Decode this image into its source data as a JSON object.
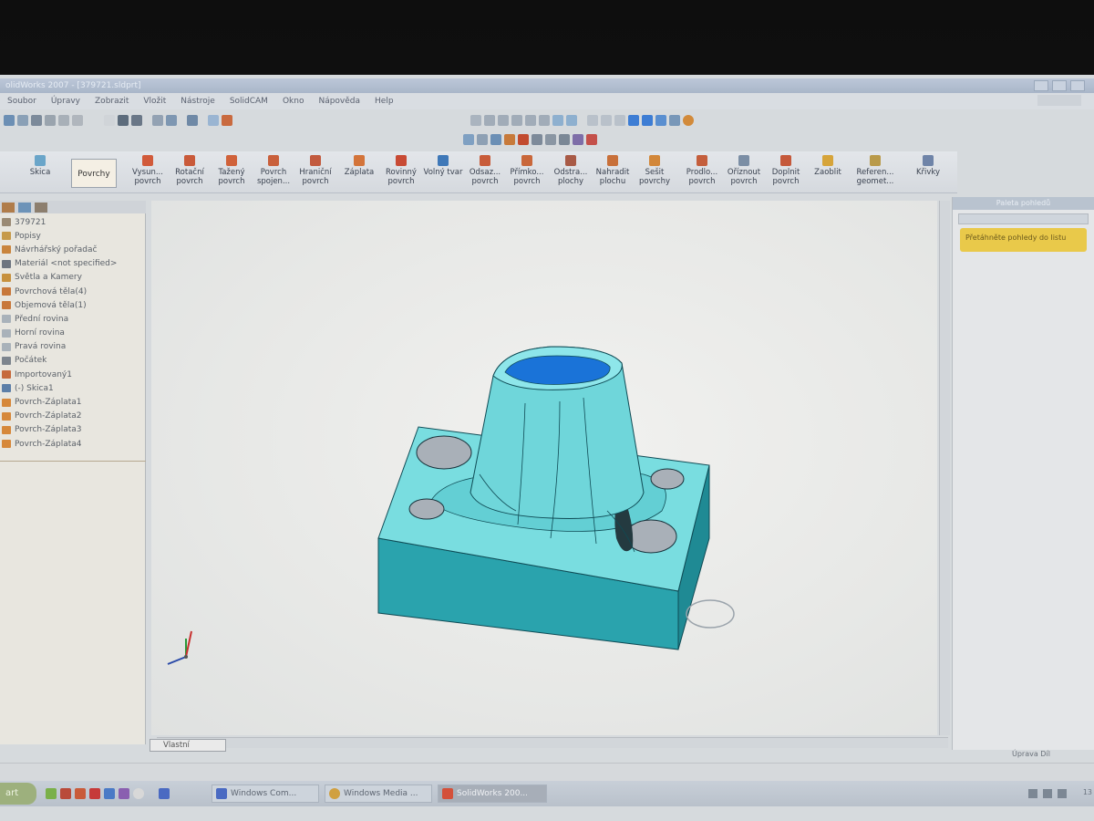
{
  "window": {
    "title": "olidWorks 2007 - [379721.sldprt]"
  },
  "menu": [
    "Soubor",
    "Úpravy",
    "Zobrazit",
    "Vložit",
    "Nástroje",
    "SolidCAM",
    "Okno",
    "Nápověda",
    "Help"
  ],
  "command_manager": {
    "sketch": "Skica",
    "surfaces": "Povrchy",
    "buttons": [
      "Vysun... povrch",
      "Rotační povrch",
      "Tažený povrch",
      "Povrch spojen...",
      "Hraniční povrch",
      "Záplata",
      "Rovinný povrch",
      "Volný tvar",
      "Odsaz... povrch",
      "Přímko... povrch",
      "Odstra... plochy",
      "Nahradit plochu",
      "Sešit povrchy",
      "Prodlo... povrch",
      "Oříznout povrch",
      "Doplnit povrch",
      "Zaoblit",
      "Referen... geomet...",
      "Křivky"
    ]
  },
  "feature_tree": [
    "379721",
    "Popisy",
    "Návrhářský pořadač",
    "Materiál <not specified>",
    "Světla a Kamery",
    "Povrchová těla(4)",
    "Objemová těla(1)",
    "Přední rovina",
    "Horní rovina",
    "Pravá rovina",
    "Počátek",
    "Importovaný1",
    "(-) Skica1",
    "Povrch-Záplata1",
    "Povrch-Záplata2",
    "Povrch-Záplata3",
    "Povrch-Záplata4"
  ],
  "viewport": {
    "view_selector": "Vlastní"
  },
  "task_pane": {
    "header": "Paleta pohledů",
    "note": "Přetáhněte pohledy do listu"
  },
  "status": {
    "edit_mode": "Úprava Díl"
  },
  "taskbar": {
    "start": "art",
    "items": [
      "Windows Com...",
      "Windows Media ...",
      "SolidWorks 200..."
    ],
    "active_index": 2,
    "clock": "13"
  },
  "colors": {
    "model_top": "#74dede",
    "model_front": "#2aa7b0",
    "model_side": "#1d8b95",
    "hole_gray": "#a9b0b8",
    "inner_blue": "#1a73d8"
  }
}
